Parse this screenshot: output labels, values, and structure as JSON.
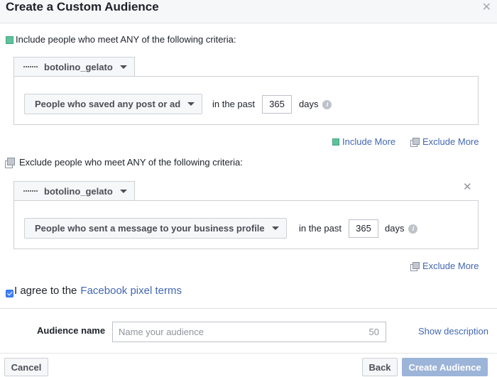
{
  "dialog": {
    "title": "Create a Custom Audience",
    "close_icon": "close-icon"
  },
  "include": {
    "heading": "Include people who meet ANY of the following criteria:",
    "source_name": "botolino_gelato",
    "rule": "People who saved any post or ad",
    "in_the_past": "in the past",
    "days_value": "365",
    "days_label": "days",
    "include_more": "Include More",
    "exclude_more": "Exclude More"
  },
  "exclude": {
    "heading": "Exclude people who meet ANY of the following criteria:",
    "source_name": "botolino_gelato",
    "rule": "People who sent a message to your business profile",
    "in_the_past": "in the past",
    "days_value": "365",
    "days_label": "days",
    "exclude_more": "Exclude More"
  },
  "terms": {
    "checked": true,
    "text": "I agree to the",
    "link": "Facebook pixel terms"
  },
  "audience": {
    "label": "Audience name",
    "placeholder": "Name your audience",
    "char_limit": "50",
    "show_description": "Show description"
  },
  "footer": {
    "cancel": "Cancel",
    "back": "Back",
    "create": "Create Audience"
  },
  "colors": {
    "link": "#4267b2",
    "include_icon": "#5fc29a",
    "primary_button_disabled": "#9cb4d8",
    "checkbox": "#4080ff"
  }
}
